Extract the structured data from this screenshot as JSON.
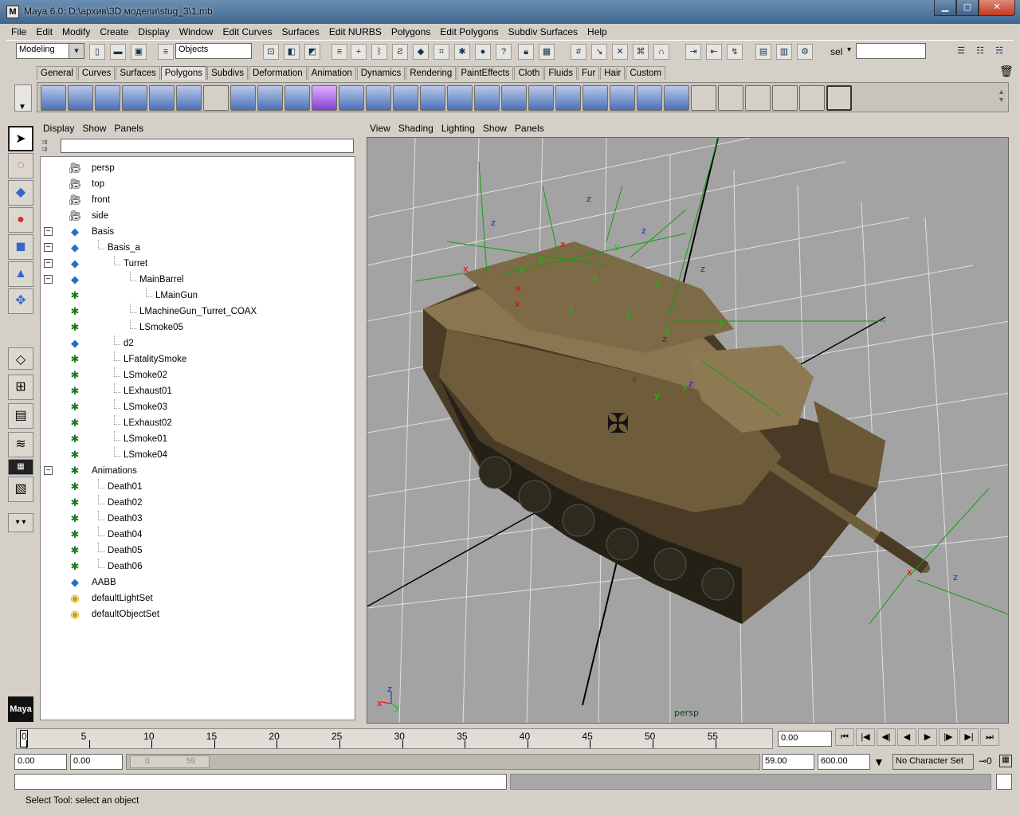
{
  "window": {
    "title": "Maya 6.0: D:\\архив\\3D модели\\stug_3\\1.mb",
    "icon_label": "M"
  },
  "menubar": [
    "File",
    "Edit",
    "Modify",
    "Create",
    "Display",
    "Window",
    "Edit Curves",
    "Surfaces",
    "Edit NURBS",
    "Polygons",
    "Edit Polygons",
    "Subdiv Surfaces",
    "Help"
  ],
  "status": {
    "menu_set": "Modeling",
    "selection_mode": "Objects",
    "sel_label": "sel"
  },
  "shelf_tabs": [
    "General",
    "Curves",
    "Surfaces",
    "Polygons",
    "Subdivs",
    "Deformation",
    "Animation",
    "Dynamics",
    "Rendering",
    "PaintEffects",
    "Cloth",
    "Fluids",
    "Fur",
    "Hair",
    "Custom"
  ],
  "shelf_active": "Polygons",
  "outliner": {
    "menu": [
      "Display",
      "Show",
      "Panels"
    ],
    "filter_value": "",
    "items": [
      {
        "label": "persp",
        "icon": "camera-icon",
        "depth": 0,
        "expander": ""
      },
      {
        "label": "top",
        "icon": "camera-icon",
        "depth": 0,
        "expander": ""
      },
      {
        "label": "front",
        "icon": "camera-icon",
        "depth": 0,
        "expander": ""
      },
      {
        "label": "side",
        "icon": "camera-icon",
        "depth": 0,
        "expander": ""
      },
      {
        "label": "Basis",
        "icon": "mesh-icon",
        "depth": 0,
        "expander": "−"
      },
      {
        "label": "Basis_a",
        "icon": "mesh-icon",
        "depth": 1,
        "expander": "−"
      },
      {
        "label": "Turret",
        "icon": "mesh-icon",
        "depth": 2,
        "expander": "−"
      },
      {
        "label": "MainBarrel",
        "icon": "mesh-icon",
        "depth": 3,
        "expander": "−"
      },
      {
        "label": "LMainGun",
        "icon": "locator-icon",
        "depth": 4,
        "expander": ""
      },
      {
        "label": "LMachineGun_Turret_COAX",
        "icon": "locator-icon",
        "depth": 3,
        "expander": ""
      },
      {
        "label": "LSmoke05",
        "icon": "locator-icon",
        "depth": 3,
        "expander": ""
      },
      {
        "label": "d2",
        "icon": "mesh-icon",
        "depth": 2,
        "expander": ""
      },
      {
        "label": "LFatalitySmoke",
        "icon": "locator-icon",
        "depth": 2,
        "expander": ""
      },
      {
        "label": "LSmoke02",
        "icon": "locator-icon",
        "depth": 2,
        "expander": ""
      },
      {
        "label": "LExhaust01",
        "icon": "locator-icon",
        "depth": 2,
        "expander": ""
      },
      {
        "label": "LSmoke03",
        "icon": "locator-icon",
        "depth": 2,
        "expander": ""
      },
      {
        "label": "LExhaust02",
        "icon": "locator-icon",
        "depth": 2,
        "expander": ""
      },
      {
        "label": "LSmoke01",
        "icon": "locator-icon",
        "depth": 2,
        "expander": ""
      },
      {
        "label": "LSmoke04",
        "icon": "locator-icon",
        "depth": 2,
        "expander": ""
      },
      {
        "label": "Animations",
        "icon": "locator-icon",
        "depth": 0,
        "expander": "−"
      },
      {
        "label": "Death01",
        "icon": "locator-icon",
        "depth": 1,
        "expander": ""
      },
      {
        "label": "Death02",
        "icon": "locator-icon",
        "depth": 1,
        "expander": ""
      },
      {
        "label": "Death03",
        "icon": "locator-icon",
        "depth": 1,
        "expander": ""
      },
      {
        "label": "Death04",
        "icon": "locator-icon",
        "depth": 1,
        "expander": ""
      },
      {
        "label": "Death05",
        "icon": "locator-icon",
        "depth": 1,
        "expander": ""
      },
      {
        "label": "Death06",
        "icon": "locator-icon",
        "depth": 1,
        "expander": ""
      },
      {
        "label": "AABB",
        "icon": "mesh-icon",
        "depth": 0,
        "expander": ""
      },
      {
        "label": "defaultLightSet",
        "icon": "set-icon",
        "depth": 0,
        "expander": ""
      },
      {
        "label": "defaultObjectSet",
        "icon": "set-icon",
        "depth": 0,
        "expander": ""
      }
    ]
  },
  "viewport": {
    "menu": [
      "View",
      "Shading",
      "Lighting",
      "Show",
      "Panels"
    ],
    "camera_label": "persp",
    "axis": {
      "x": "x",
      "y": "y",
      "z": "z"
    }
  },
  "timeline": {
    "ticks": [
      "0",
      "5",
      "10",
      "15",
      "20",
      "25",
      "30",
      "35",
      "40",
      "45",
      "50",
      "55"
    ],
    "current_frame": "0.00"
  },
  "range": {
    "anim_start": "0.00",
    "range_start": "0.00",
    "slider_left": "0",
    "slider_right": "59",
    "range_end": "59.00",
    "anim_end": "600.00",
    "character_set": "No Character Set"
  },
  "help_line": "Select Tool: select an object",
  "colors": {
    "viewport_bg": "#a3a3a3",
    "grid": "#dcdcdc",
    "axis_x": "#e00000",
    "axis_y": "#00d000",
    "axis_z": "#2020d0",
    "tank": "#7a6a4a"
  }
}
